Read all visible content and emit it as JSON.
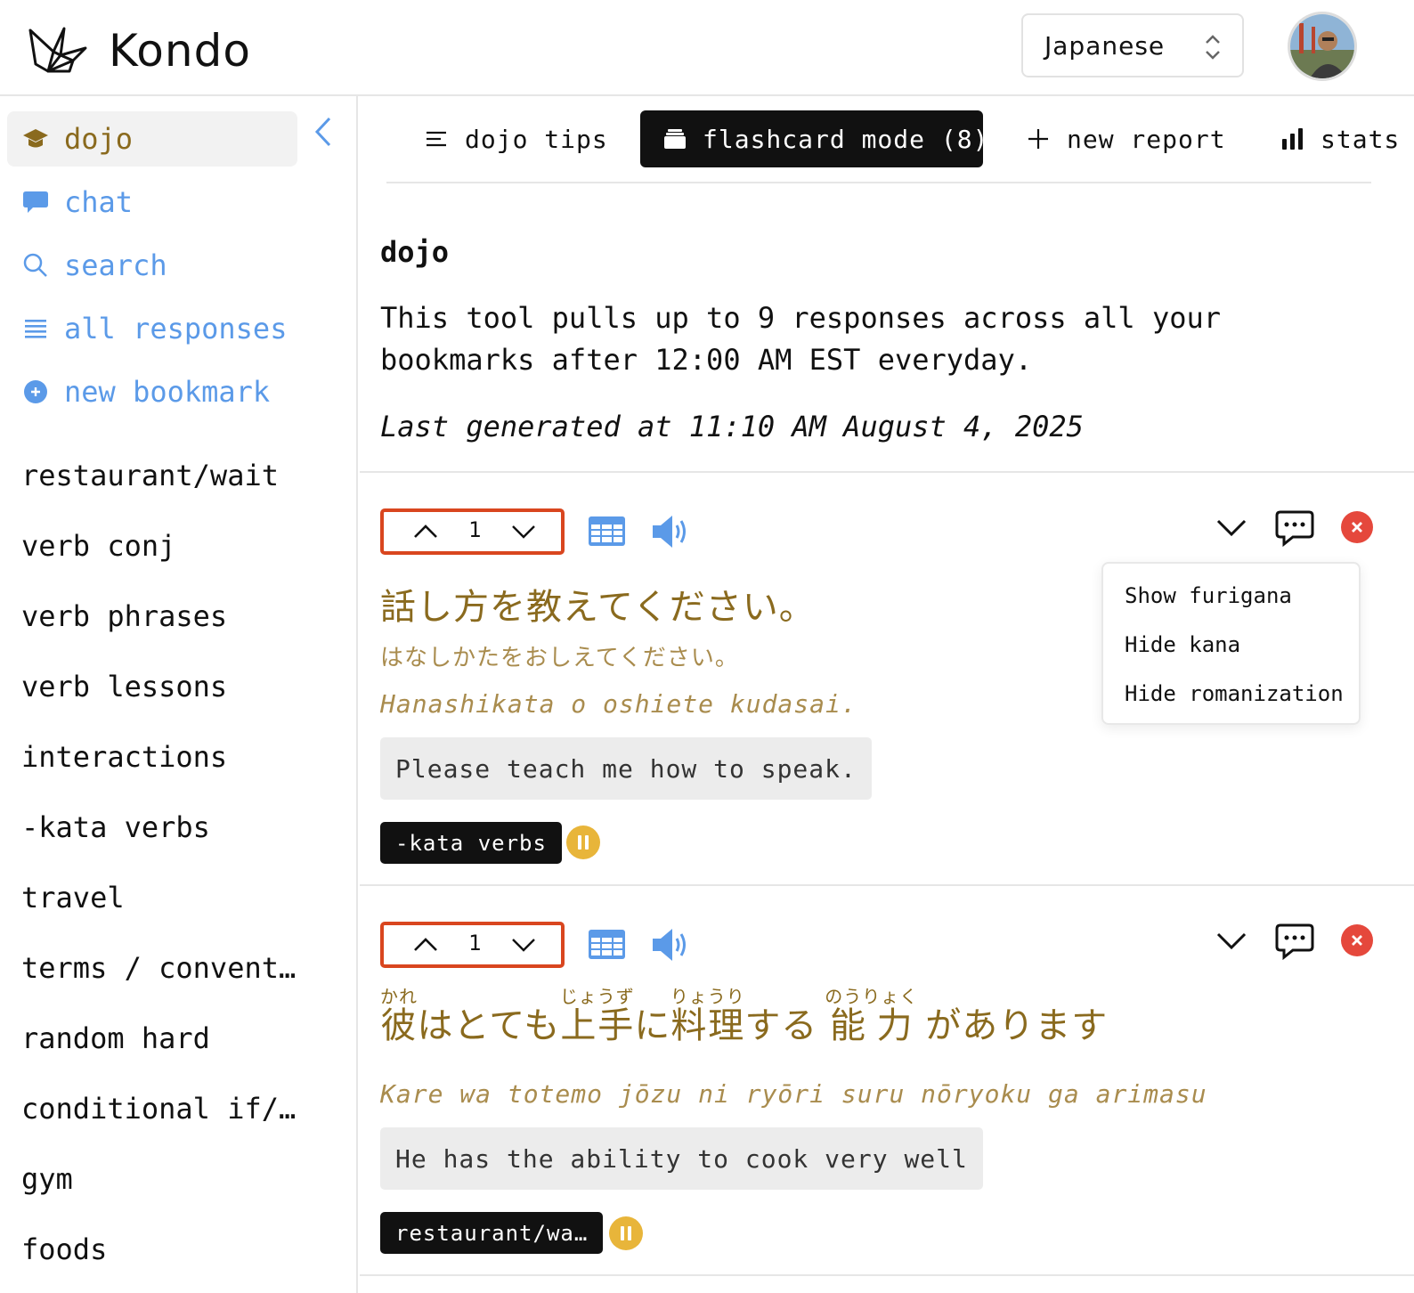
{
  "app": {
    "brand": "Kondo",
    "language": "Japanese"
  },
  "sidebar": {
    "nav": [
      {
        "label": "dojo",
        "icon": "graduation-cap-icon",
        "active": true
      },
      {
        "label": "chat",
        "icon": "chat-bubble-icon"
      },
      {
        "label": "search",
        "icon": "search-icon"
      },
      {
        "label": "all responses",
        "icon": "list-icon"
      },
      {
        "label": "new bookmark",
        "icon": "plus-circle-icon"
      }
    ],
    "bookmarks": [
      "restaurant/wait",
      "verb conj",
      "verb phrases",
      "verb lessons",
      "interactions",
      "-kata verbs",
      "travel",
      "terms / convent…",
      "random hard",
      "conditional if/…",
      "gym",
      "foods"
    ]
  },
  "tabs": [
    {
      "label": "dojo tips",
      "icon": "menu-lines-icon"
    },
    {
      "label": "flashcard mode (8)",
      "icon": "card-stack-icon",
      "active": true
    },
    {
      "label": "new report",
      "icon": "plus-icon"
    },
    {
      "label": "stats",
      "icon": "bar-chart-icon"
    }
  ],
  "intro": {
    "title": "dojo",
    "description": "This tool pulls up to 9 responses across all your bookmarks after 12:00 AM EST everyday.",
    "last_generated": "Last generated at 11:10 AM August 4, 2025"
  },
  "cards": [
    {
      "count": "1",
      "japanese": "話し方を教えてください。",
      "kana": "はなしかたをおしえてください。",
      "romaji": "Hanashikata o oshiete kudasai.",
      "translation": "Please teach me how to speak.",
      "tag": "-kata verbs"
    },
    {
      "count": "1",
      "segments": [
        {
          "text": "彼",
          "ruby": "かれ"
        },
        {
          "text": "はとても"
        },
        {
          "text": "上手",
          "ruby": "じょうず"
        },
        {
          "text": "に"
        },
        {
          "text": "料理",
          "ruby": "りょうり"
        },
        {
          "text": "する "
        },
        {
          "text": "能力",
          "ruby": "のうりょく"
        },
        {
          "text": " があります"
        }
      ],
      "romaji": "Kare wa totemo jōzu ni ryōri suru nōryoku ga arimasu",
      "translation": "He has the ability to cook very well",
      "tag": "restaurant/wa…"
    }
  ],
  "dropdown": {
    "items": [
      "Show furigana",
      "Hide kana",
      "Hide romanization"
    ]
  },
  "colors": {
    "accent_gold": "#8a6a1e",
    "nav_blue": "#5b9ae8",
    "stepper_border": "#d9461f",
    "close_red": "#e5483c",
    "pause_yellow": "#e8b53a"
  }
}
